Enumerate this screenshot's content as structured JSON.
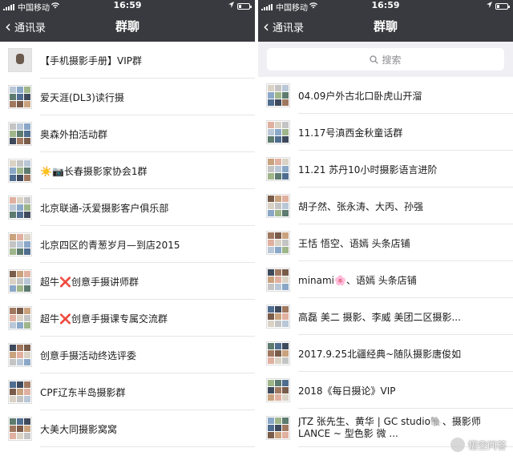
{
  "status_bar": {
    "carrier": "中国移动",
    "time": "16:59"
  },
  "left": {
    "back_label": "通讯录",
    "title": "群聊",
    "groups": [
      "【手机摄影手册】VIP群",
      "爱天涯(DL3)读行摄",
      "奥森外拍活动群",
      "☀️📷长春摄影家协会1群",
      "北京联通-沃爱摄影客户俱乐部",
      "北京四区的青葱岁月—到店2015",
      "超牛❌创意手摄讲师群",
      "超牛❌创意手摄课专属交流群",
      "创意手摄活动终选评委",
      "CPF辽东半岛摄影群",
      "大美大同摄影窝窝"
    ]
  },
  "right": {
    "back_label": "通讯录",
    "title": "群聊",
    "search_placeholder": "搜索",
    "groups": [
      "04.09户外古北口卧虎山开溜",
      "11.17号滇西金秋童话群",
      "11.21 苏丹10小时摄影语言进阶",
      "胡子然、张永涛、大丙、孙强",
      "王恬 悟空、语嫣 头条店铺",
      "minami🌸、语嫣 头条店铺",
      "高磊 美二 摄影、李威 美团二区摄影...",
      "2017.9.25北疆经典~随队摄影唐俊如",
      "2018《每日摄论》VIP",
      "JTZ 张先生、黄华 | GC studio🐘、摄影师LANCE ~ 型色影 微 ..."
    ]
  },
  "watermark": "悟空问答",
  "colors": {
    "nav_bg": "#393a3f",
    "search_bg": "#efeff4",
    "divider": "#e6e6e6"
  }
}
